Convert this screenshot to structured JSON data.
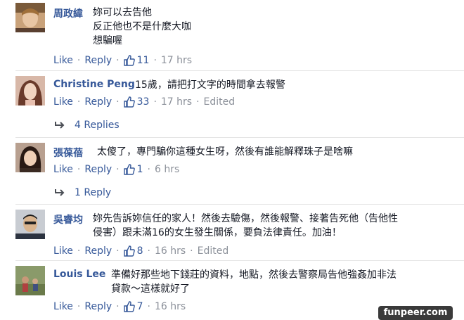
{
  "comments": [
    {
      "name": "周政緯",
      "text": "妳可以去告他\n反正他也不是什麼大咖\n想騙喔",
      "like": "Like",
      "reply": "Reply",
      "like_count": "11",
      "time": "17 hrs",
      "edited": ""
    },
    {
      "name": "Christine Peng",
      "text": "15歲，請把打文字的時間拿去報警",
      "like": "Like",
      "reply": "Reply",
      "like_count": "33",
      "time": "17 hrs",
      "edited": "Edited",
      "replies": "4 Replies"
    },
    {
      "name": "張葆蓓",
      "text": "太傻了，專門騙你這種女生呀，然後有誰能解釋珠子是啥嘛",
      "like": "Like",
      "reply": "Reply",
      "like_count": "1",
      "time": "6 hrs",
      "edited": "",
      "replies": "1 Reply"
    },
    {
      "name": "吳睿均",
      "text": "妳先告訴妳信任的家人！然後去驗傷，然後報警、接著告死他（告他性\n侵害）跟未滿16的女生發生關係，要負法律責任。加油！",
      "like": "Like",
      "reply": "Reply",
      "like_count": "8",
      "time": "16 hrs",
      "edited": "Edited"
    },
    {
      "name": "Louis Lee",
      "text": "準備好那些地下錢莊的資料，地點，然後去警察局告他強姦加非法\n貸款～這樣就好了",
      "like": "Like",
      "reply": "Reply",
      "like_count": "7",
      "time": "16 hrs",
      "edited": ""
    }
  ],
  "watermark": "funpeer.com",
  "colors": {
    "link": "#365899",
    "meta": "#8c919a",
    "text": "#141823"
  },
  "icons": [
    "thumbs-up-icon",
    "reply-arrow-icon"
  ]
}
